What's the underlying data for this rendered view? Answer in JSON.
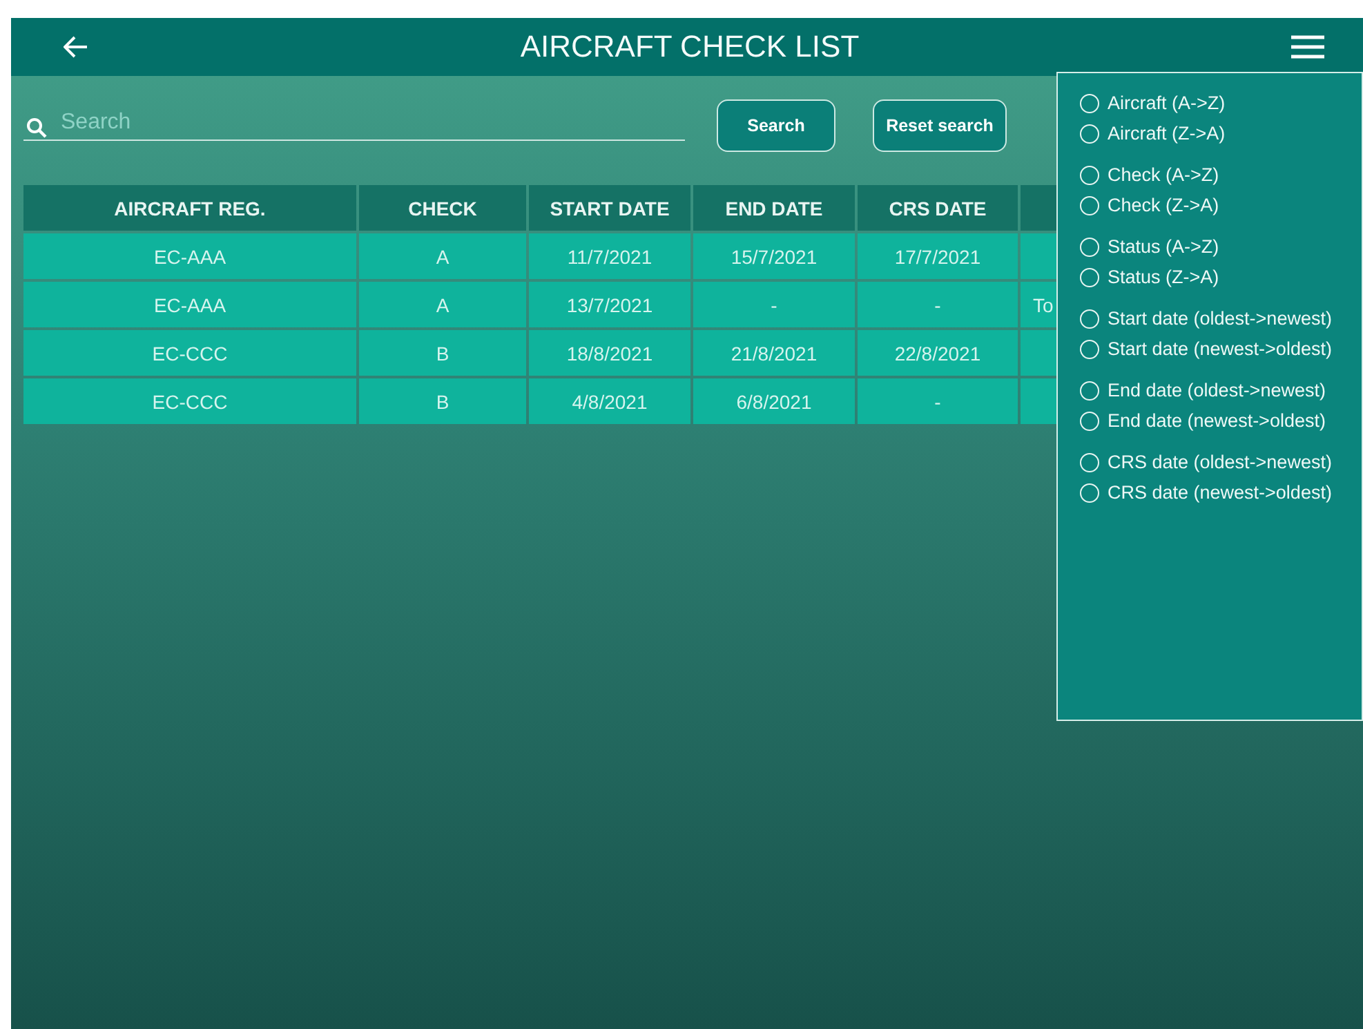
{
  "header": {
    "title": "AIRCRAFT CHECK LIST"
  },
  "search": {
    "placeholder": "Search"
  },
  "buttons": [
    "Search",
    "Reset search"
  ],
  "table": {
    "columns": [
      "AIRCRAFT REG.",
      "CHECK",
      "START DATE",
      "END DATE",
      "CRS DATE"
    ],
    "rows": [
      {
        "cells": [
          "EC-AAA",
          "A",
          "11/7/2021",
          "15/7/2021",
          "17/7/2021"
        ]
      },
      {
        "cells": [
          "EC-AAA",
          "A",
          "13/7/2021",
          "-",
          "-"
        ],
        "column_6": "To"
      },
      {
        "cells": [
          "EC-CCC",
          "B",
          "18/8/2021",
          "21/8/2021",
          "22/8/2021"
        ]
      },
      {
        "cells": [
          "EC-CCC",
          "B",
          "4/8/2021",
          "6/8/2021",
          "-"
        ]
      }
    ]
  },
  "sort_menu": {
    "groups": [
      [
        {
          "label": "Aircraft (A->Z)",
          "selected": false
        },
        {
          "label": "Aircraft (Z->A)",
          "selected": false
        }
      ],
      [
        {
          "label": "Check (A->Z)",
          "selected": false
        },
        {
          "label": "Check (Z->A)",
          "selected": false
        }
      ],
      [
        {
          "label": "Status (A->Z)",
          "selected": false
        },
        {
          "label": "Status (Z->A)",
          "selected": false
        }
      ],
      [
        {
          "label": "Start date (oldest->newest)",
          "selected": false
        },
        {
          "label": "Start date (newest->oldest)",
          "selected": false
        }
      ],
      [
        {
          "label": "End date (oldest->newest)",
          "selected": false
        },
        {
          "label": "End date (newest->oldest)",
          "selected": false
        }
      ],
      [
        {
          "label": "CRS date (oldest->newest)",
          "selected": false
        },
        {
          "label": "CRS date (newest->oldest)",
          "selected": false
        }
      ]
    ]
  }
}
